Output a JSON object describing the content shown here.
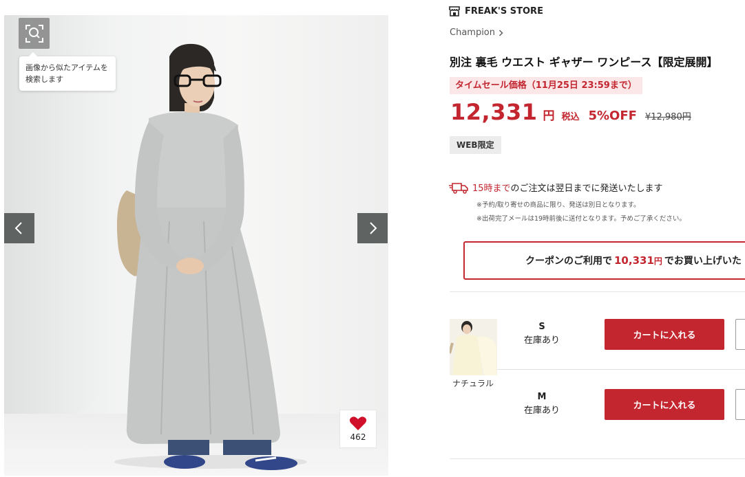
{
  "gallery": {
    "lens_tooltip": "画像から似たアイテムを\n検索します",
    "favorite_count": "462"
  },
  "product": {
    "store_name": "FREAK'S STORE",
    "brand": "Champion",
    "title": "別注 裏毛 ウエスト ギャザー ワンピース【限定展開】",
    "sale_label": "タイムセール価格（11月25日 23:59まで）",
    "price": "12,331",
    "currency": "円",
    "tax_label": "税込",
    "discount": "5%OFF",
    "original_price": "¥12,980円",
    "web_badge": "WEB限定"
  },
  "shipping": {
    "deadline": "15時まで",
    "text": "のご注文は翌日までに発送いたします",
    "note1": "※予約/取り寄せの商品に限り、発送は別日となります。",
    "note2": "※出荷完了メールは19時前後に送付となります。予めご了承ください。"
  },
  "coupon": {
    "prefix": "クーポンのご利用で",
    "amount": "10,331",
    "unit": "円",
    "suffix": "でお買い上げいた"
  },
  "variant": {
    "color_name": "ナチュラル",
    "sizes": [
      {
        "size": "S",
        "stock": "在庫あり",
        "cart_label": "カートに入れる"
      },
      {
        "size": "M",
        "stock": "在庫あり",
        "cart_label": "カートに入れる"
      }
    ]
  },
  "colors": {
    "accent": "#c3262f",
    "sale_badge_bg": "#fbe6e8",
    "heart": "#d0102a"
  }
}
